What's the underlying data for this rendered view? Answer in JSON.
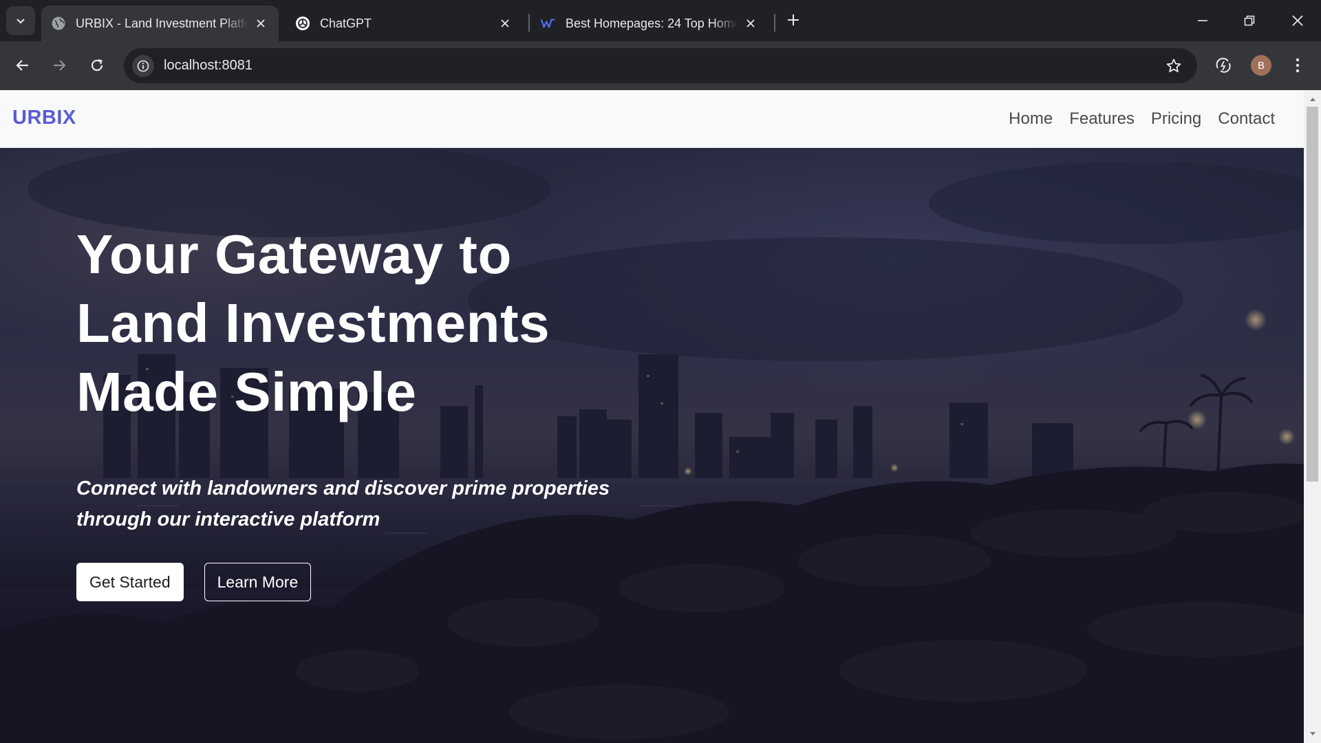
{
  "browser": {
    "tabs": [
      {
        "title": "URBIX - Land Investment Platform",
        "icon": "globe-icon",
        "active": true
      },
      {
        "title": "ChatGPT",
        "icon": "chatgpt-logo-icon",
        "active": false
      },
      {
        "title": "Best Homepages: 24 Top Homepage Examples",
        "icon": "webflow-logo-icon",
        "active": false
      }
    ],
    "address": "localhost:8081",
    "profile_initial": "B",
    "colors": {
      "frame": "#202124",
      "toolbar": "#35363a",
      "profile": "#a1705a"
    }
  },
  "site": {
    "brand": "URBIX",
    "brand_color": "#5b5bd6",
    "nav": [
      "Home",
      "Features",
      "Pricing",
      "Contact"
    ],
    "hero": {
      "title_lines": [
        "Your Gateway to",
        "Land Investments",
        "Made Simple"
      ],
      "subtitle": "Connect with landowners and discover prime properties through our interactive platform",
      "primary_cta": "Get Started",
      "secondary_cta": "Learn More"
    }
  }
}
